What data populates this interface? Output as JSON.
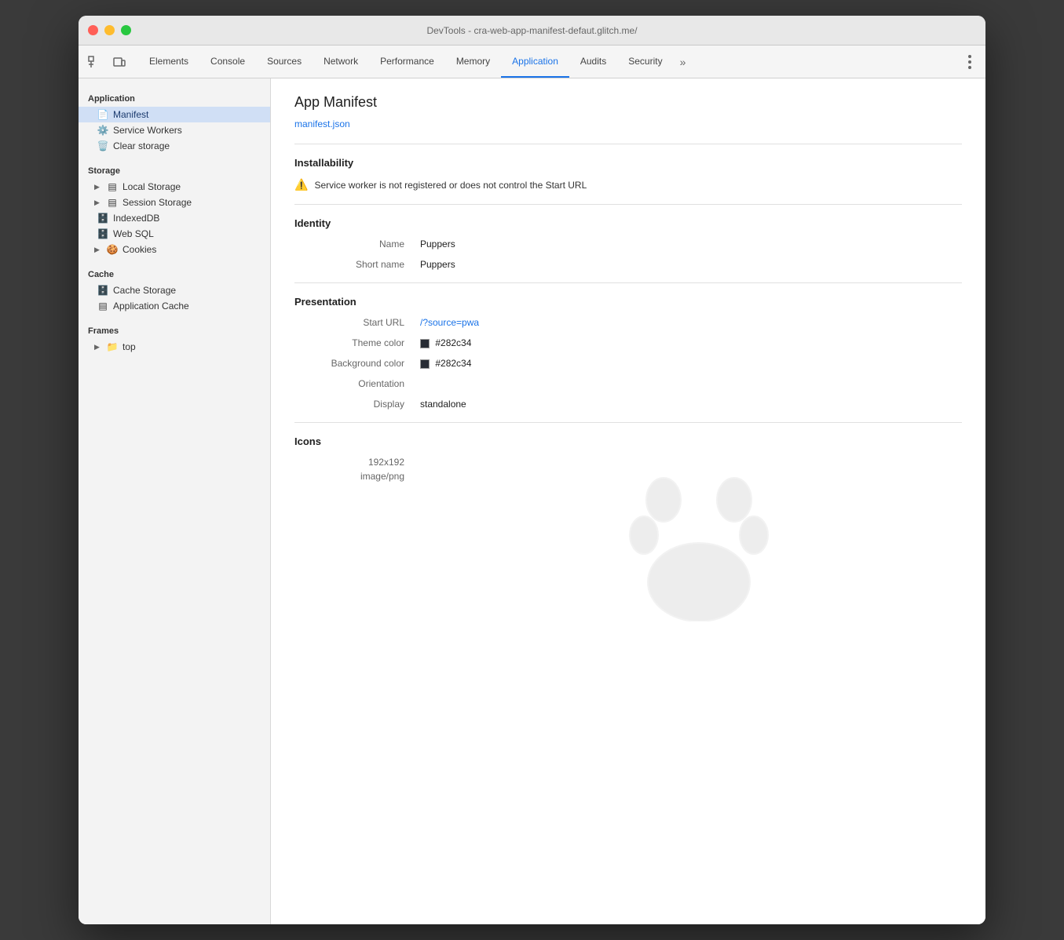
{
  "window": {
    "title": "DevTools - cra-web-app-manifest-defaut.glitch.me/"
  },
  "tabs": [
    {
      "label": "Elements",
      "active": false
    },
    {
      "label": "Console",
      "active": false
    },
    {
      "label": "Sources",
      "active": false
    },
    {
      "label": "Network",
      "active": false
    },
    {
      "label": "Performance",
      "active": false
    },
    {
      "label": "Memory",
      "active": false
    },
    {
      "label": "Application",
      "active": true
    },
    {
      "label": "Audits",
      "active": false
    },
    {
      "label": "Security",
      "active": false
    }
  ],
  "sidebar": {
    "application_section": "Application",
    "items_application": [
      {
        "label": "Manifest",
        "icon": "📄",
        "active": true
      },
      {
        "label": "Service Workers",
        "icon": "⚙️",
        "active": false
      },
      {
        "label": "Clear storage",
        "icon": "🗑️",
        "active": false
      }
    ],
    "storage_section": "Storage",
    "items_storage": [
      {
        "label": "Local Storage",
        "icon": "▤",
        "expandable": true
      },
      {
        "label": "Session Storage",
        "icon": "▤",
        "expandable": true
      },
      {
        "label": "IndexedDB",
        "icon": "🗄️",
        "expandable": false
      },
      {
        "label": "Web SQL",
        "icon": "🗄️",
        "expandable": false
      },
      {
        "label": "Cookies",
        "icon": "🍪",
        "expandable": true
      }
    ],
    "cache_section": "Cache",
    "items_cache": [
      {
        "label": "Cache Storage",
        "icon": "🗄️",
        "expandable": false
      },
      {
        "label": "Application Cache",
        "icon": "▤",
        "expandable": false
      }
    ],
    "frames_section": "Frames",
    "items_frames": [
      {
        "label": "top",
        "icon": "📁",
        "expandable": true
      }
    ]
  },
  "content": {
    "page_title": "App Manifest",
    "manifest_link": "manifest.json",
    "installability": {
      "title": "Installability",
      "warning": "Service worker is not registered or does not control the Start URL"
    },
    "identity": {
      "title": "Identity",
      "name_label": "Name",
      "name_value": "Puppers",
      "short_name_label": "Short name",
      "short_name_value": "Puppers"
    },
    "presentation": {
      "title": "Presentation",
      "start_url_label": "Start URL",
      "start_url_value": "/?source=pwa",
      "theme_color_label": "Theme color",
      "theme_color_value": "#282c34",
      "bg_color_label": "Background color",
      "bg_color_value": "#282c34",
      "orientation_label": "Orientation",
      "orientation_value": "",
      "display_label": "Display",
      "display_value": "standalone"
    },
    "icons": {
      "title": "Icons",
      "size": "192x192",
      "type": "image/png"
    }
  }
}
